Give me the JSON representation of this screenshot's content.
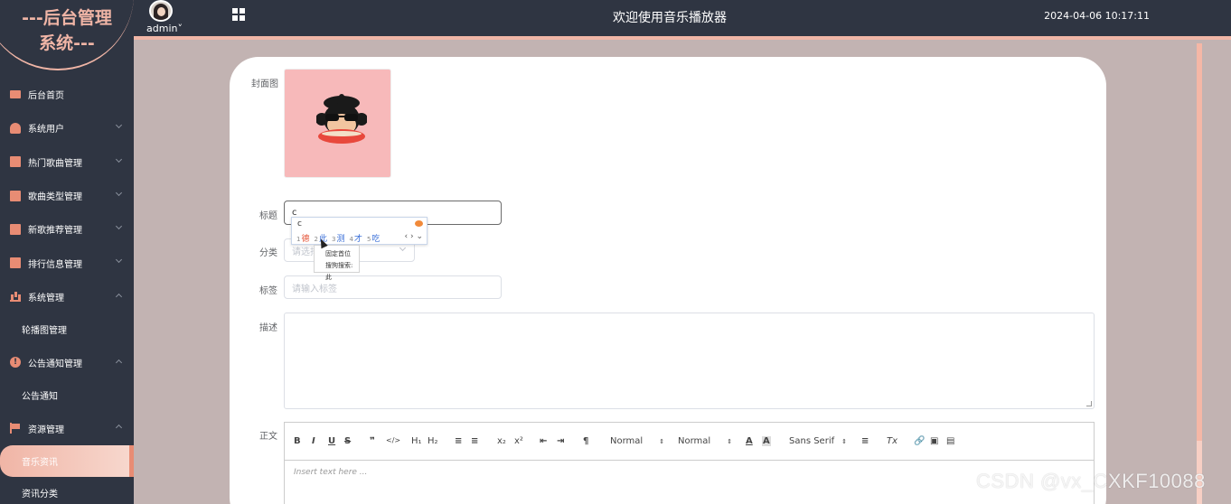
{
  "logo": {
    "line1": "---后台管理",
    "line2": "系统---"
  },
  "header": {
    "username": "admin",
    "username_caret": "˅",
    "title": "欢迎使用音乐播放器",
    "datetime": "2024-04-06 10:17:11"
  },
  "sidebar": {
    "items": [
      {
        "label": "后台首页"
      },
      {
        "label": "系统用户"
      },
      {
        "label": "热门歌曲管理"
      },
      {
        "label": "歌曲类型管理"
      },
      {
        "label": "新歌推荐管理"
      },
      {
        "label": "排行信息管理"
      },
      {
        "label": "系统管理"
      },
      {
        "label": "轮播图管理"
      },
      {
        "label": "公告通知管理"
      },
      {
        "label": "公告通知"
      },
      {
        "label": "资源管理"
      },
      {
        "label": "音乐资讯"
      },
      {
        "label": "资讯分类"
      }
    ],
    "info_glyph": "!"
  },
  "form": {
    "cover_label": "封面图",
    "title_label": "标题",
    "title_value": "c",
    "category_label": "分类",
    "category_placeholder": "请选择",
    "tag_label": "标签",
    "tag_placeholder": "请输入标签",
    "desc_label": "描述",
    "body_label": "正文"
  },
  "ime": {
    "input": "c",
    "candidates": [
      {
        "num": "1",
        "text": "德"
      },
      {
        "num": "2",
        "text": "此"
      },
      {
        "num": "3",
        "text": "测"
      },
      {
        "num": "4",
        "text": "才"
      },
      {
        "num": "5",
        "text": "吃"
      }
    ],
    "nav": "‹ › ⌄",
    "menu": [
      "固定首位",
      "搜狗搜索:此"
    ]
  },
  "editor": {
    "bold": "B",
    "italic": "I",
    "underline": "U",
    "strike": "S",
    "quote": "❞",
    "code": "</>",
    "h1": "H₁",
    "h2": "H₂",
    "ol": "≡",
    "ul": "≡",
    "sub": "x₂",
    "sup": "x²",
    "outdent": "⇤",
    "indent": "⇥",
    "direction": "¶",
    "size": "Normal",
    "header": "Normal",
    "color": "A",
    "bg": "A",
    "font": "Sans Serif",
    "align": "≡",
    "clean": "Tx",
    "link": "🔗",
    "image": "▣",
    "video": "▤",
    "select_arrow": "⇕",
    "placeholder": "Insert text here ..."
  },
  "watermark": "CSDN @vx_CXKF10088",
  "colors": {
    "sidebar_bg": "#2f3542",
    "accent": "#f0b5a6",
    "content_bg": "#c2b3b2"
  }
}
